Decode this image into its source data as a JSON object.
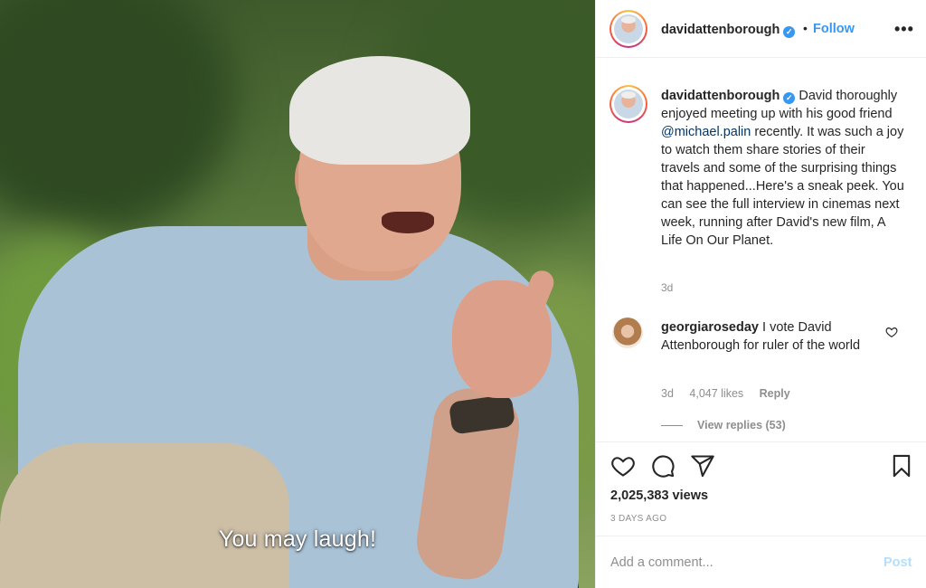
{
  "media": {
    "subtitle": "You may laugh!"
  },
  "header": {
    "username": "davidattenborough",
    "dot": "•",
    "follow_label": "Follow",
    "more_label": "•••"
  },
  "caption": {
    "username": "davidattenborough",
    "text_before": "David thoroughly enjoyed meeting up with his good friend",
    "mention": "@michael.palin",
    "text_after": "recently. It was such a joy to watch them share stories of their travels and some of the surprising things that happened...Here's a sneak peek. You can see the full interview in cinemas next week, running after David's new film, A Life On Our Planet.",
    "time": "3d"
  },
  "comment": {
    "username": "georgiaroseday",
    "text": "I vote David Attenborough for ruler of the world",
    "time": "3d",
    "likes": "4,047 likes",
    "reply_label": "Reply",
    "view_replies": "View replies (53)"
  },
  "stats": {
    "views": "2,025,383 views",
    "date": "3 DAYS AGO"
  },
  "compose": {
    "placeholder": "Add a comment...",
    "post_label": "Post"
  },
  "colors": {
    "link": "#3897f0",
    "mention": "#00376b",
    "muted": "#8e8e8e",
    "post_disabled": "#b2dffc"
  },
  "icons": [
    "verified-badge-icon",
    "more-options-icon",
    "heart-icon",
    "comment-icon",
    "share-icon",
    "bookmark-icon"
  ]
}
